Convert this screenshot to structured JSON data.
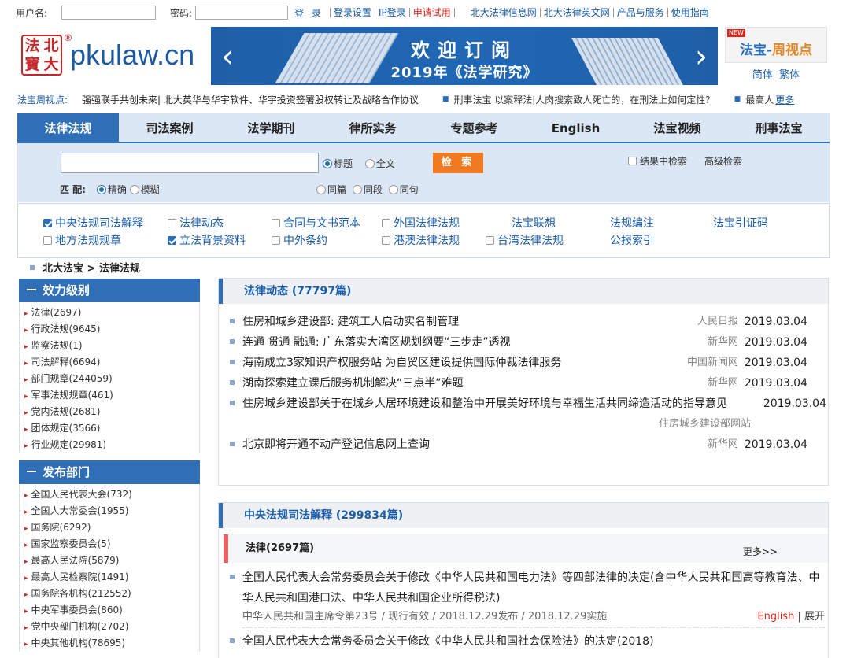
{
  "topbar": {
    "username_label": "用户名:",
    "password_label": "密码:",
    "login": "登 录",
    "links": [
      "登录设置",
      "IP登录",
      "申请试用"
    ],
    "links2": [
      "北大法律信息网",
      "北大法律英文网",
      "产品与服务",
      "使用指南"
    ]
  },
  "logo": {
    "seal_chars": [
      "法",
      "北",
      "寶",
      "大"
    ],
    "reg": "®",
    "text": "pkulaw.cn"
  },
  "banner": {
    "line1": "欢迎订阅",
    "line2": "2019年《法学研究》"
  },
  "weekly": {
    "new_badge": "NEW",
    "title_a": "法宝-",
    "title_b": "周视点",
    "lang_simplified": "简体",
    "lang_traditional": "繁体"
  },
  "ticker": {
    "label": "法宝周视点:",
    "item1": "强强联手共创未来| 北大英华与华宇软件、华宇投资签署股权转让及战略合作协议",
    "item2": "刑事法宝 以案释法|人肉搜索致人死亡的，在刑法上如何定性?",
    "item3": "最高人",
    "more": "更多"
  },
  "nav": {
    "tabs": [
      "法律法规",
      "司法案例",
      "法学期刊",
      "律所实务",
      "专题参考",
      "English",
      "法宝视频",
      "刑事法宝"
    ]
  },
  "search": {
    "scope_title": "标题",
    "scope_full": "全文",
    "button": "检 索",
    "within_results": "结果中检索",
    "advanced": "高级检索",
    "match_label": "匹 配:",
    "match_exact": "精确",
    "match_fuzzy": "模糊",
    "same_article": "同篇",
    "same_para": "同段",
    "same_sentence": "同句"
  },
  "categories": {
    "row1": [
      "中央法规司法解释",
      "法律动态",
      "合同与文书范本",
      "外国法律法规",
      "法宝联想",
      "法规编注",
      "法宝引证码"
    ],
    "row2": [
      "地方法规规章",
      "立法背景资料",
      "中外条约",
      "港澳法律法规",
      "台湾法律法规",
      "公报索引"
    ]
  },
  "breadcrumb": "北大法宝 > 法律法规",
  "sidebar": {
    "level_title": "效力级别",
    "level_items": [
      "法律(2697)",
      "行政法规(9645)",
      "监察法规(1)",
      "司法解释(6694)",
      "部门规章(244059)",
      "军事法规规章(461)",
      "党内法规(2681)",
      "团体规定(3566)",
      "行业规定(29981)"
    ],
    "dept_title": "发布部门",
    "dept_items": [
      "全国人民代表大会(732)",
      "全国人大常委会(1955)",
      "国务院(6292)",
      "国家监察委员会(5)",
      "最高人民法院(5879)",
      "最高人民检察院(1491)",
      "国务院各机构(212552)",
      "中央军事委员会(860)",
      "党中央部门机构(2702)",
      "中央其他机构(78695)"
    ]
  },
  "dynamics": {
    "title": "法律动态 (77797篇)",
    "items": [
      {
        "title": "住房和城乡建设部: 建筑工人启动实名制管理",
        "source": "人民日报",
        "date": "2019.03.04"
      },
      {
        "title": "连通 贯通 融通: 广东落实大湾区规划纲要“三步走”透视",
        "source": "新华网",
        "date": "2019.03.04"
      },
      {
        "title": "海南成立3家知识产权服务站 为自贸区建设提供国际仲裁法律服务",
        "source": "中国新闻网",
        "date": "2019.03.04"
      },
      {
        "title": "湖南探索建立课后服务机制解决“三点半”难题",
        "source": "新华网",
        "date": "2019.03.04"
      },
      {
        "title": "住房城乡建设部关于在城乡人居环境建设和整治中开展美好环境与幸福生活共同缔造活动的指导意见",
        "source": "住房城乡建设部网站",
        "date": "2019.03.04"
      },
      {
        "title": "北京即将开通不动产登记信息网上查询",
        "source": "新华网",
        "date": "2019.03.04"
      }
    ]
  },
  "central": {
    "title": "中央法规司法解释 (299834篇)",
    "sub_title": "法律(2697篇)",
    "more": "更多>>",
    "law1_title": "全国人民代表大会常务委员会关于修改《中华人民共和国电力法》等四部法律的决定(含中华人民共和国高等教育法、中华人民共和国港口法、中华人民共和国企业所得税法)",
    "law1_meta": "中华人民共和国主席令第23号 / 现行有效 / 2018.12.29发布 / 2018.12.29实施",
    "law1_en": "English",
    "law1_expand": "展开",
    "law2_title": "全国人民代表大会常务委员会关于修改《中华人民共和国社会保险法》的决定(2018)"
  }
}
